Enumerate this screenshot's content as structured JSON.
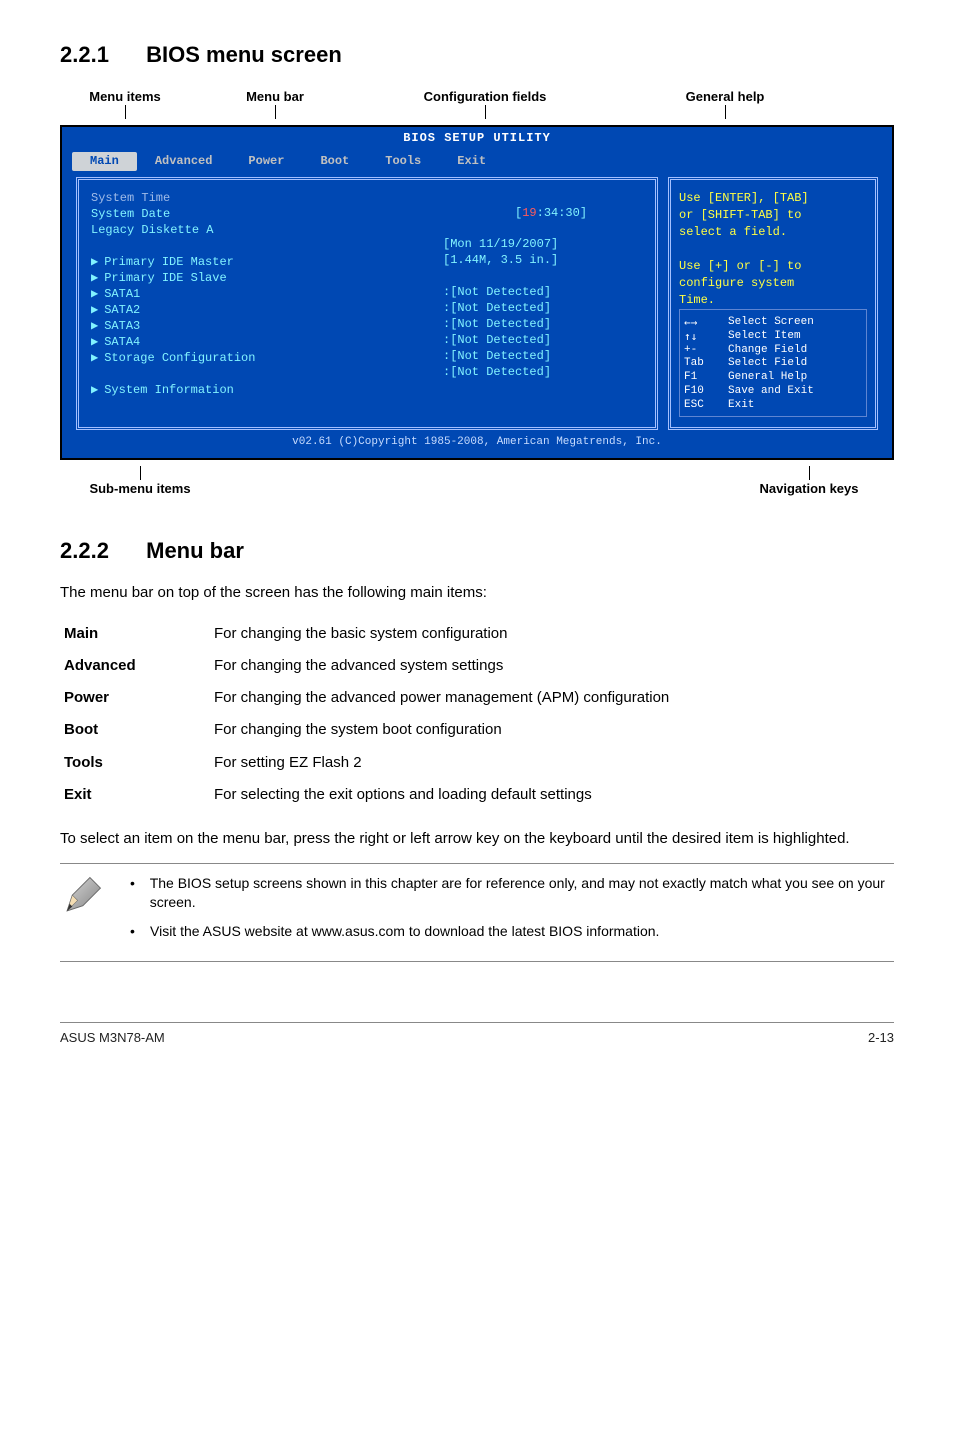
{
  "section1": {
    "num": "2.2.1",
    "title": "BIOS menu screen"
  },
  "section2": {
    "num": "2.2.2",
    "title": "Menu bar"
  },
  "top_labels": {
    "menu_items": "Menu items",
    "menu_bar": "Menu bar",
    "config_fields": "Configuration fields",
    "general_help": "General help"
  },
  "bottom_labels": {
    "submenu": "Sub-menu items",
    "navkeys": "Navigation keys"
  },
  "bios": {
    "title": "BIOS SETUP UTILITY",
    "tabs": [
      "Main",
      "Advanced",
      "Power",
      "Boot",
      "Tools",
      "Exit"
    ],
    "left": {
      "sys_time_label": "System Time",
      "sys_date_label": "System Date",
      "legacy_label": "Legacy Diskette A",
      "sys_time_val": "[19:34:30]",
      "sys_time_hour": "19",
      "sys_time_rest": ":34:30]",
      "sys_date_val": "[Mon 11/19/2007]",
      "legacy_val": "[1.44M, 3.5 in.]",
      "items": [
        "Primary IDE Master",
        "Primary IDE Slave",
        "SATA1",
        "SATA2",
        "SATA3",
        "SATA4",
        "Storage Configuration"
      ],
      "item_vals": [
        ":[Not Detected]",
        ":[Not Detected]",
        ":[Not Detected]",
        ":[Not Detected]",
        ":[Not Detected]",
        ":[Not Detected]",
        ""
      ],
      "sysinfo": "System Information"
    },
    "help": {
      "l1": "Use [ENTER], [TAB]",
      "l2": "or [SHIFT-TAB] to",
      "l3": "select a field.",
      "l4": "Use [+] or [-] to",
      "l5": "configure system",
      "l6": "Time."
    },
    "nav": [
      {
        "k": "←→",
        "d": "Select Screen"
      },
      {
        "k": "↑↓",
        "d": "Select Item"
      },
      {
        "k": "+-",
        "d": "Change Field"
      },
      {
        "k": "Tab",
        "d": "Select Field"
      },
      {
        "k": "F1",
        "d": "General Help"
      },
      {
        "k": "F10",
        "d": "Save and Exit"
      },
      {
        "k": "ESC",
        "d": "Exit"
      }
    ],
    "footer": "v02.61 (C)Copyright 1985-2008, American Megatrends, Inc."
  },
  "s2_intro": "The menu bar on top of the screen has the following main items:",
  "defs": [
    {
      "k": "Main",
      "d": "For changing the basic system configuration"
    },
    {
      "k": "Advanced",
      "d": "For changing the advanced system settings"
    },
    {
      "k": "Power",
      "d": "For changing the advanced power management (APM) configuration"
    },
    {
      "k": "Boot",
      "d": "For changing the system boot configuration"
    },
    {
      "k": "Tools",
      "d": "For setting EZ Flash 2"
    },
    {
      "k": "Exit",
      "d": "For selecting the exit options and loading default settings"
    }
  ],
  "s2_outro": "To select an item on the menu bar, press the right or left arrow key on the keyboard until the desired item is highlighted.",
  "notes": [
    "The BIOS setup screens shown in this chapter are for reference only, and may not exactly match what you see on your screen.",
    "Visit the ASUS website at www.asus.com to download the latest BIOS information."
  ],
  "footer": {
    "left": "ASUS M3N78-AM",
    "right": "2-13"
  }
}
